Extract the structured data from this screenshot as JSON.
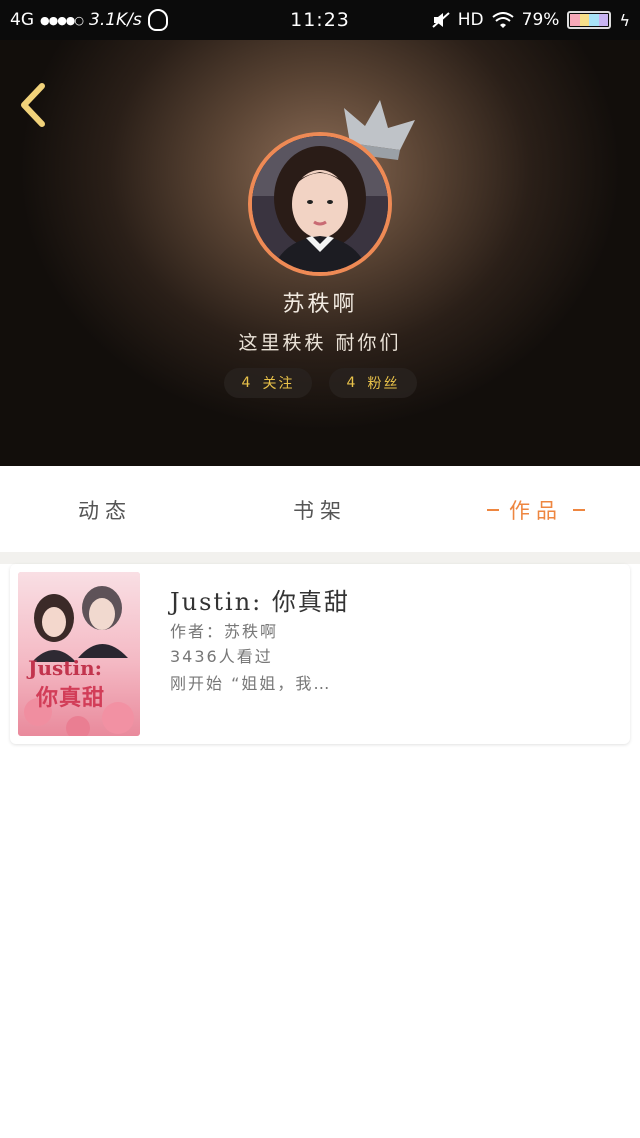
{
  "status_bar": {
    "network": "4G",
    "signal": "●●●●○",
    "speed": "3.1K/s",
    "time": "11:23",
    "hd": "HD",
    "battery": "79%"
  },
  "profile": {
    "nickname": "苏秩啊",
    "signature": "这里秩秩 耐你们",
    "following_count": "4",
    "following_label": "关注",
    "fans_count": "4",
    "fans_label": "粉丝"
  },
  "tabs": [
    {
      "label": "动态"
    },
    {
      "label": "书架"
    },
    {
      "label": "作品",
      "active": true
    }
  ],
  "works": [
    {
      "title": "Justin: 你真甜",
      "author_label": "作者：",
      "author": "苏秩啊",
      "views": "3436人看过",
      "excerpt": "刚开始 “姐姐，我…",
      "cover_text_line1": "Justin:",
      "cover_text_line2": "你真甜"
    }
  ],
  "colors": {
    "accent": "#ee8640",
    "stat_text": "#e9c24a",
    "avatar_ring": "#ee8a55",
    "back_arrow": "#f1d27a"
  }
}
